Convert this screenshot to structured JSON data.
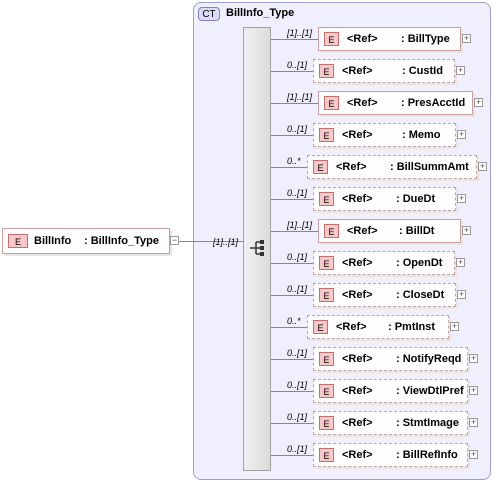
{
  "complex_type": {
    "badge": "CT",
    "name": "BillInfo_Type"
  },
  "root": {
    "badge": "E",
    "name": "BillInfo",
    "type": ": BillInfo_Type",
    "cardinality": "[1]..[1]"
  },
  "elements": [
    {
      "badge": "E",
      "ref": "<Ref>",
      "name": ": BillType",
      "card": "[1]..[1]",
      "optional": false
    },
    {
      "badge": "E",
      "ref": "<Ref>",
      "name": ": CustId",
      "card": "0..[1]",
      "optional": true
    },
    {
      "badge": "E",
      "ref": "<Ref>",
      "name": ": PresAcctId",
      "card": "[1]..[1]",
      "optional": false
    },
    {
      "badge": "E",
      "ref": "<Ref>",
      "name": ": Memo",
      "card": "0..[1]",
      "optional": true
    },
    {
      "badge": "E",
      "ref": "<Ref>",
      "name": ": BillSummAmt",
      "card": "0..*",
      "optional": true
    },
    {
      "badge": "E",
      "ref": "<Ref>",
      "name": ": DueDt",
      "card": "0..[1]",
      "optional": true
    },
    {
      "badge": "E",
      "ref": "<Ref>",
      "name": ": BillDt",
      "card": "[1]..[1]",
      "optional": false
    },
    {
      "badge": "E",
      "ref": "<Ref>",
      "name": ": OpenDt",
      "card": "0..[1]",
      "optional": true
    },
    {
      "badge": "E",
      "ref": "<Ref>",
      "name": ": CloseDt",
      "card": "0..[1]",
      "optional": true
    },
    {
      "badge": "E",
      "ref": "<Ref>",
      "name": ": PmtInst",
      "card": "0..*",
      "optional": true
    },
    {
      "badge": "E",
      "ref": "<Ref>",
      "name": ": NotifyReqd",
      "card": "0..[1]",
      "optional": true
    },
    {
      "badge": "E",
      "ref": "<Ref>",
      "name": ": ViewDtlPref",
      "card": "0..[1]",
      "optional": true
    },
    {
      "badge": "E",
      "ref": "<Ref>",
      "name": ": StmtImage",
      "card": "0..[1]",
      "optional": true
    },
    {
      "badge": "E",
      "ref": "<Ref>",
      "name": ": BillRefInfo",
      "card": "0..[1]",
      "optional": true
    }
  ]
}
